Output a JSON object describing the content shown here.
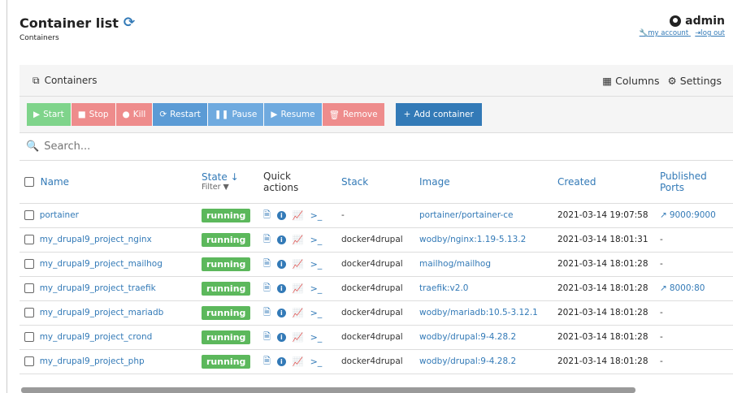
{
  "header": {
    "title": "Container list",
    "breadcrumb": "Containers",
    "user": "admin",
    "my_account": "my account",
    "log_out": "log out"
  },
  "panel": {
    "title": "Containers",
    "columns_label": "Columns",
    "settings_label": "Settings"
  },
  "toolbar": {
    "start": "Start",
    "stop": "Stop",
    "kill": "Kill",
    "restart": "Restart",
    "pause": "Pause",
    "resume": "Resume",
    "remove": "Remove",
    "add": "Add container"
  },
  "search": {
    "placeholder": "Search..."
  },
  "table": {
    "headers": {
      "name": "Name",
      "state": "State",
      "filter": "Filter",
      "quick": "Quick",
      "actions": "actions",
      "stack": "Stack",
      "image": "Image",
      "created": "Created",
      "published": "Published",
      "ports": "Ports"
    },
    "rows": [
      {
        "name": "portainer",
        "state": "running",
        "stack": "-",
        "image": "portainer/portainer-ce",
        "created": "2021-03-14 19:07:58",
        "ports": "9000:9000"
      },
      {
        "name": "my_drupal9_project_nginx",
        "state": "running",
        "stack": "docker4drupal",
        "image": "wodby/nginx:1.19-5.13.2",
        "created": "2021-03-14 18:01:31",
        "ports": "-"
      },
      {
        "name": "my_drupal9_project_mailhog",
        "state": "running",
        "stack": "docker4drupal",
        "image": "mailhog/mailhog",
        "created": "2021-03-14 18:01:28",
        "ports": "-"
      },
      {
        "name": "my_drupal9_project_traefik",
        "state": "running",
        "stack": "docker4drupal",
        "image": "traefik:v2.0",
        "created": "2021-03-14 18:01:28",
        "ports": "8000:80"
      },
      {
        "name": "my_drupal9_project_mariadb",
        "state": "running",
        "stack": "docker4drupal",
        "image": "wodby/mariadb:10.5-3.12.1",
        "created": "2021-03-14 18:01:28",
        "ports": "-"
      },
      {
        "name": "my_drupal9_project_crond",
        "state": "running",
        "stack": "docker4drupal",
        "image": "wodby/drupal:9-4.28.2",
        "created": "2021-03-14 18:01:28",
        "ports": "-"
      },
      {
        "name": "my_drupal9_project_php",
        "state": "running",
        "stack": "docker4drupal",
        "image": "wodby/drupal:9-4.28.2",
        "created": "2021-03-14 18:01:28",
        "ports": "-"
      }
    ]
  },
  "colors": {
    "accent": "#337ab7",
    "running": "#5cb85c",
    "danger": "#ee8c8c",
    "success": "#7fd48b"
  }
}
